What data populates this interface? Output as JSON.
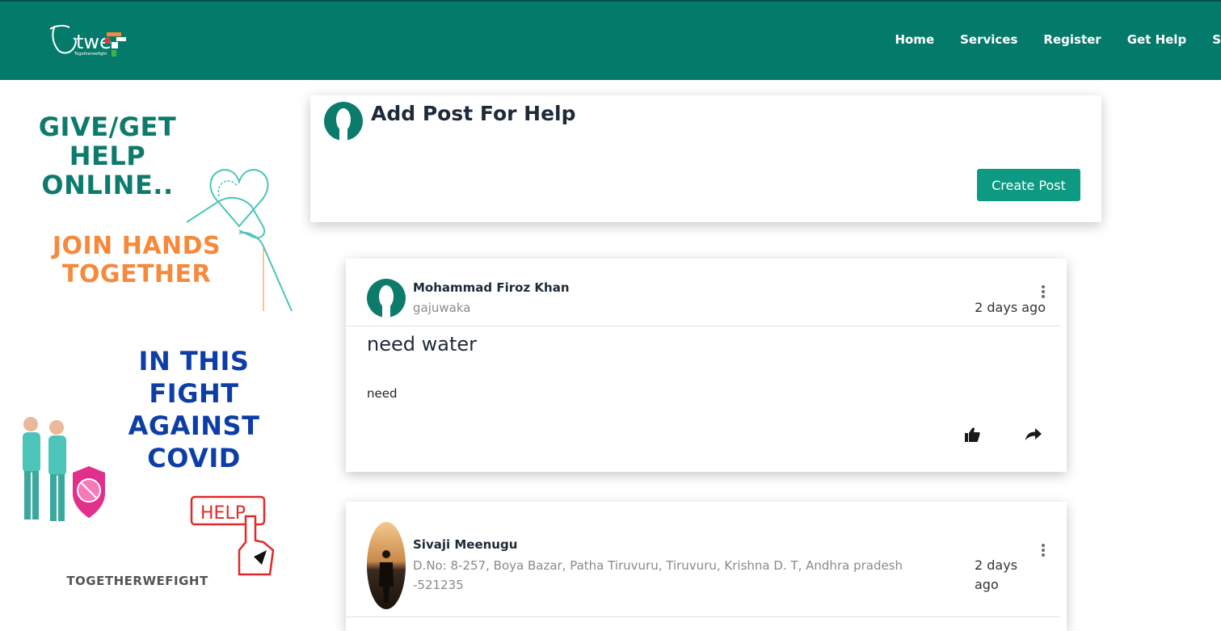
{
  "nav": {
    "logo_text": "twe",
    "logo_tagline": "Togetherwefight",
    "links": [
      "Home",
      "Services",
      "Register",
      "Get Help",
      "S"
    ]
  },
  "banner": {
    "line_give": "GIVE/GET HELP ONLINE..",
    "line_join": "JOIN HANDS TOGETHER",
    "line_fight": "IN THIS FIGHT AGAINST COVID",
    "help_sign": "HELP",
    "footer": "TOGETHERWEFIGHT"
  },
  "add_post": {
    "title": "Add Post For Help",
    "button": "Create Post"
  },
  "posts": [
    {
      "author": "Mohammad Firoz Khan",
      "location": "gajuwaka",
      "time": "2 days ago",
      "title": "need water",
      "body": "need"
    },
    {
      "author": "Sivaji Meenugu",
      "location": "D.No: 8-257, Boya Bazar, Patha Tiruvuru, Tiruvuru, Krishna D. T, Andhra pradesh -521235",
      "time": "2 days ago"
    }
  ],
  "colors": {
    "brand": "#047a6a",
    "button": "#0e9a82",
    "banner_green": "#0d7b6c",
    "banner_orange": "#f58a3c",
    "banner_blue": "#0d3ea8"
  },
  "icons": [
    "kebab-menu-icon",
    "thumbs-up-icon",
    "share-icon",
    "user-avatar-icon"
  ]
}
